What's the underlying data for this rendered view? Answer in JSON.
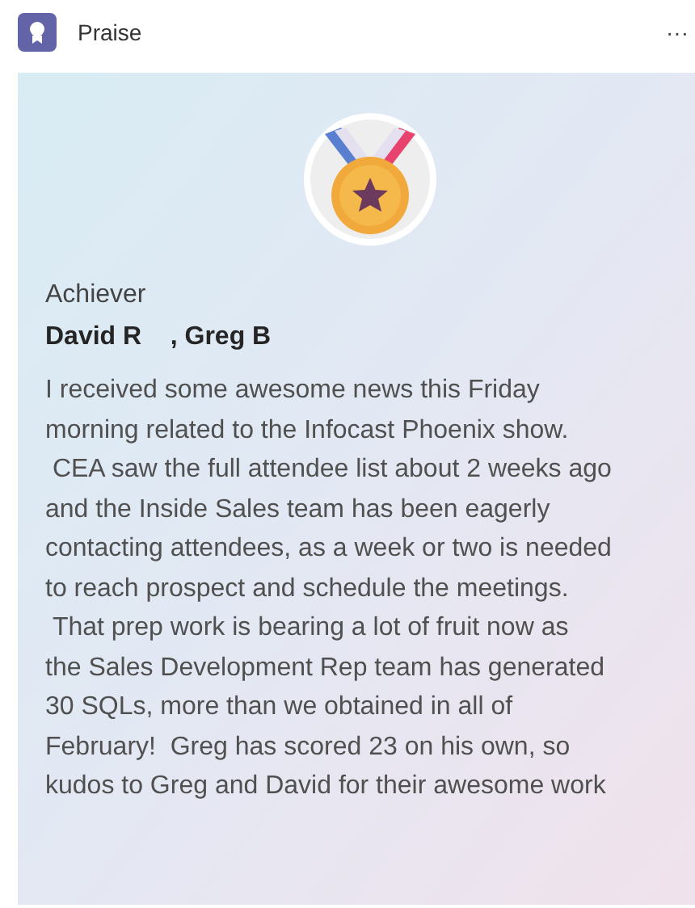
{
  "header": {
    "title": "Praise",
    "menu": "···"
  },
  "card": {
    "badge": "Achiever",
    "recipients": "David R    , Greg B",
    "message_lines": [
      "I received some awesome news this Friday",
      "morning related to the Infocast Phoenix show.",
      " CEA saw the full attendee list about 2 weeks ago",
      "and the Inside Sales team has been eagerly",
      "contacting attendees, as a week or two is needed",
      "to reach prospect and schedule the meetings.",
      " That prep work is bearing a lot of fruit now as",
      "the Sales Development Rep team has generated",
      "30 SQLs, more than we obtained in all of",
      "February!  Greg has scored 23 on his own, so",
      "kudos to Greg and David for their awesome work"
    ]
  }
}
